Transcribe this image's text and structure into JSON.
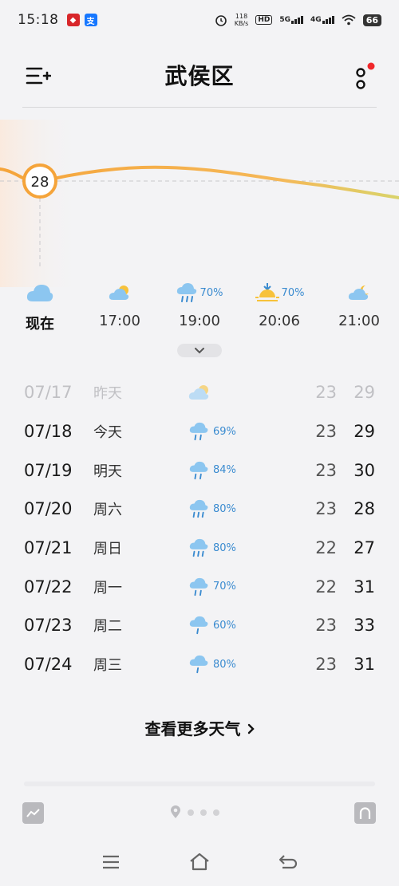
{
  "status_bar": {
    "time": "15:18",
    "app_icons": [
      "app-red-icon",
      "alipay-icon"
    ],
    "net_speed_value": "118",
    "net_speed_unit": "KB/s",
    "hd_badge": "HD",
    "sim1_net": "5G",
    "sim2_net": "4G",
    "battery": "66"
  },
  "header": {
    "city": "武侯区"
  },
  "current": {
    "temp": "28"
  },
  "hourly": [
    {
      "label": "现在",
      "icon": "cloudy-icon",
      "precip": ""
    },
    {
      "label": "17:00",
      "icon": "partly-cloudy-icon",
      "precip": ""
    },
    {
      "label": "19:00",
      "icon": "rain-icon",
      "precip": "70%"
    },
    {
      "label": "20:06",
      "icon": "sunset-icon",
      "precip": "70%"
    },
    {
      "label": "21:00",
      "icon": "partly-cloudy-night-icon",
      "precip": ""
    }
  ],
  "daily": [
    {
      "date": "07/17",
      "name": "昨天",
      "icon": "partly-cloudy-icon",
      "precip": "",
      "low": "23",
      "high": "29"
    },
    {
      "date": "07/18",
      "name": "今天",
      "icon": "rain-icon",
      "precip": "69%",
      "low": "23",
      "high": "29"
    },
    {
      "date": "07/19",
      "name": "明天",
      "icon": "rain-icon",
      "precip": "84%",
      "low": "23",
      "high": "30"
    },
    {
      "date": "07/20",
      "name": "周六",
      "icon": "heavy-rain-icon",
      "precip": "80%",
      "low": "23",
      "high": "28"
    },
    {
      "date": "07/21",
      "name": "周日",
      "icon": "heavy-rain-icon",
      "precip": "80%",
      "low": "22",
      "high": "27"
    },
    {
      "date": "07/22",
      "name": "周一",
      "icon": "rain-icon",
      "precip": "70%",
      "low": "22",
      "high": "31"
    },
    {
      "date": "07/23",
      "name": "周二",
      "icon": "rain-icon",
      "precip": "60%",
      "low": "23",
      "high": "33"
    },
    {
      "date": "07/24",
      "name": "周三",
      "icon": "rain-icon",
      "precip": "80%",
      "low": "23",
      "high": "31"
    }
  ],
  "more_weather": {
    "label": "查看更多天气"
  },
  "colors": {
    "accent_orange": "#f5a43a",
    "rain_blue": "#3a8bd0",
    "cloud_blue": "#8cc6f0",
    "sun_yellow": "#f7c23b"
  }
}
